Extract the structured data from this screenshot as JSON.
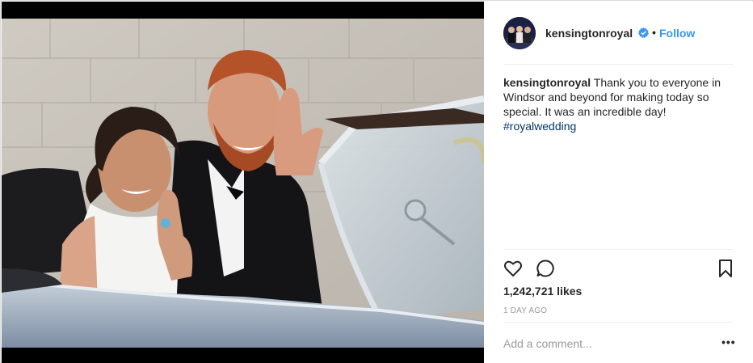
{
  "post": {
    "username": "kensingtonroyal",
    "follow_label": "Follow",
    "dot": "•",
    "caption_text": "Thank you to everyone in Windsor and beyond for making today so special. It was an incredible day!",
    "hashtag": "#royalwedding",
    "likes": "1,242,721 likes",
    "timestamp": "1 DAY AGO",
    "more_label": "•••"
  },
  "comment": {
    "placeholder": "Add a comment..."
  },
  "icons": {
    "verified": "verified-badge-icon",
    "like": "heart-icon",
    "comment": "comment-bubble-icon",
    "save": "bookmark-icon",
    "more": "more-options-icon"
  },
  "colors": {
    "link": "#3897f0",
    "hashtag": "#003569",
    "muted": "#999999",
    "divider": "#efefef"
  }
}
